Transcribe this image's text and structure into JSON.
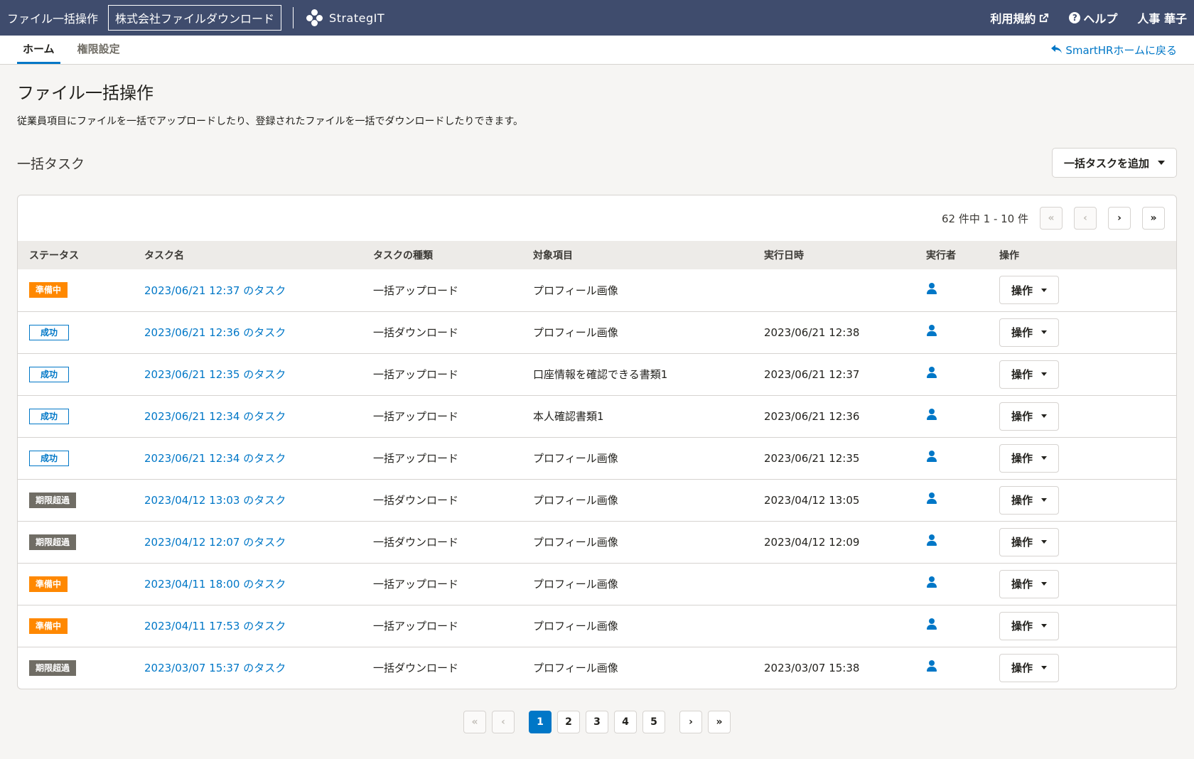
{
  "header": {
    "app_name": "ファイル一括操作",
    "company": "株式会社ファイルダウンロード",
    "logo_text": "StrategIT",
    "terms_label": "利用規約",
    "help_label": "ヘルプ",
    "user_name": "人事 華子",
    "help_glyph": "?"
  },
  "tabs": [
    {
      "label": "ホーム",
      "active": true
    },
    {
      "label": "権限設定",
      "active": false
    }
  ],
  "back_link": "SmartHRホームに戻る",
  "page": {
    "title": "ファイル一括操作",
    "description": "従業員項目にファイルを一括でアップロードしたり、登録されたファイルを一括でダウンロードしたりできます。"
  },
  "section": {
    "title": "一括タスク",
    "add_button": "一括タスクを追加"
  },
  "pagination_top": {
    "count": "62 件中 1 - 10 件",
    "first": "«",
    "prev": "‹",
    "next": "›",
    "last": "»"
  },
  "table": {
    "columns": [
      "ステータス",
      "タスク名",
      "タスクの種類",
      "対象項目",
      "実行日時",
      "実行者",
      "操作"
    ],
    "op_label": "操作",
    "rows": [
      {
        "status": "準備中",
        "status_type": "preparing",
        "name": "2023/06/21 12:37 のタスク",
        "type": "一括アップロード",
        "target": "プロフィール画像",
        "date": ""
      },
      {
        "status": "成功",
        "status_type": "success",
        "name": "2023/06/21 12:36 のタスク",
        "type": "一括ダウンロード",
        "target": "プロフィール画像",
        "date": "2023/06/21 12:38"
      },
      {
        "status": "成功",
        "status_type": "success",
        "name": "2023/06/21 12:35 のタスク",
        "type": "一括アップロード",
        "target": "口座情報を確認できる書類1",
        "date": "2023/06/21 12:37"
      },
      {
        "status": "成功",
        "status_type": "success",
        "name": "2023/06/21 12:34 のタスク",
        "type": "一括アップロード",
        "target": "本人確認書類1",
        "date": "2023/06/21 12:36"
      },
      {
        "status": "成功",
        "status_type": "success",
        "name": "2023/06/21 12:34 のタスク",
        "type": "一括アップロード",
        "target": "プロフィール画像",
        "date": "2023/06/21 12:35"
      },
      {
        "status": "期限超過",
        "status_type": "expired",
        "name": "2023/04/12 13:03 のタスク",
        "type": "一括ダウンロード",
        "target": "プロフィール画像",
        "date": "2023/04/12 13:05"
      },
      {
        "status": "期限超過",
        "status_type": "expired",
        "name": "2023/04/12 12:07 のタスク",
        "type": "一括ダウンロード",
        "target": "プロフィール画像",
        "date": "2023/04/12 12:09"
      },
      {
        "status": "準備中",
        "status_type": "preparing",
        "name": "2023/04/11 18:00 のタスク",
        "type": "一括アップロード",
        "target": "プロフィール画像",
        "date": ""
      },
      {
        "status": "準備中",
        "status_type": "preparing",
        "name": "2023/04/11 17:53 のタスク",
        "type": "一括アップロード",
        "target": "プロフィール画像",
        "date": ""
      },
      {
        "status": "期限超過",
        "status_type": "expired",
        "name": "2023/03/07 15:37 のタスク",
        "type": "一括ダウンロード",
        "target": "プロフィール画像",
        "date": "2023/03/07 15:38"
      }
    ]
  },
  "pagination_bottom": {
    "first": "«",
    "prev": "‹",
    "pages": [
      "1",
      "2",
      "3",
      "4",
      "5"
    ],
    "current_page": "1",
    "next": "›",
    "last": "»"
  },
  "colors": {
    "header_bg": "#3f4c6d",
    "accent": "#0077c7",
    "preparing": "#ff8800",
    "expired": "#706d65"
  }
}
